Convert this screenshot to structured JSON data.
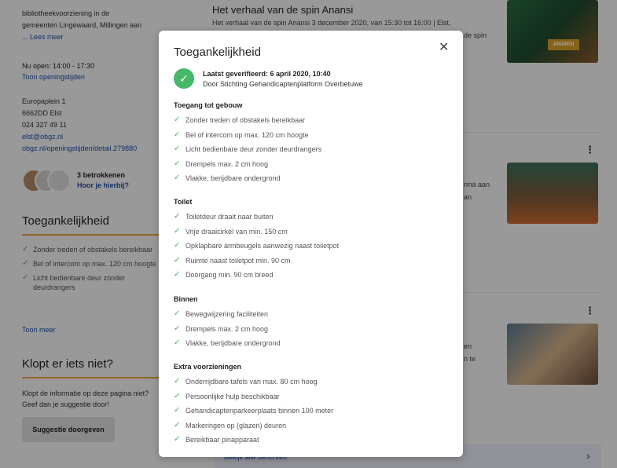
{
  "left": {
    "description_lines": [
      "bibliotheekvoorziening in de",
      "gemeenten Lingewaard, Millingen aan"
    ],
    "description_more": "... Lees meer",
    "open_now": "Nu open: 14:00 - 17:30",
    "show_hours": "Toon openingstijden",
    "address_line1": "Europaplein 1",
    "address_line2": "6662DD Elst",
    "phone": "024 327 49 11",
    "email": "elst@obgz.nl",
    "url": "obgz.nl/openingstijden/detail.279880",
    "involved_count": "3 betrokkenen",
    "involved_join": "Hoor je hierbij?",
    "accessibility_title": "Toegankelijkheid",
    "accessibility_items": [
      "Zonder treden of obstakels bereikbaar",
      "Bel of intercom op max. 120 cm hoogte",
      "Licht bedienbare deur zonder deurdrangers"
    ],
    "show_more": "Toon meer",
    "feedback_title": "Klopt er iets niet?",
    "feedback_text": "Klopt de informatie op deze pagina niet? Geef dan je suggestie door!",
    "feedback_button": "Suggestie doorgeven"
  },
  "right": {
    "story_title": "Het verhaal van de spin Anansi",
    "story_text": "Het verhaal van de spin Anansi 3 december 2020, van 15:30 tot 16:00 | Elst,",
    "story_frag": "de spin",
    "thumb1_label": "ANANSI",
    "frag_a": "rma aan",
    "frag_b": "an",
    "frag_c": "en",
    "frag_d": "n te",
    "kebab": "⋮",
    "bottom_link": "Bekijk alle berichten",
    "bottom_arrow": "›"
  },
  "modal": {
    "title": "Toegankelijkheid",
    "close": "✕",
    "verified_line1": "Laatst geverifieerd: 6 april 2020, 10:40",
    "verified_line2": "Door Stichting Gehandicaptenplatform Overbetuwe",
    "verified_icon": "✓",
    "categories": [
      {
        "title": "Toegang tot gebouw",
        "items": [
          "Zonder treden of obstakels bereikbaar",
          "Bel of intercom op max. 120 cm hoogte",
          "Licht bedienbare deur zonder deurdrangers",
          "Drempels max. 2 cm hoog",
          "Vlakke, berijdbare ondergrond"
        ]
      },
      {
        "title": "Toilet",
        "items": [
          "Toiletdeur draait naar buiten",
          "Vrije draaicirkel van min. 150 cm",
          "Opklapbare armbeugels aanwezig naast toiletpot",
          "Ruimte naast toiletpot min. 90 cm",
          "Doorgang min. 90 cm breed"
        ]
      },
      {
        "title": "Binnen",
        "items": [
          "Bewegwijzering faciliteiten",
          "Drempels max. 2 cm hoog",
          "Vlakke, berijdbare ondergrond"
        ]
      },
      {
        "title": "Extra voorzieningen",
        "items": [
          "Onderrijdbare tafels van max. 80 cm hoog",
          "Persoonlijke hulp beschikbaar",
          "Gehandicaptenparkeerplaats binnen 100 meter",
          "Markeringen op (glazen) deuren",
          "Bereikbaar pinapparaat"
        ]
      }
    ]
  },
  "icons": {
    "check": "✓"
  },
  "colors": {
    "accent_orange": "#e8a23f",
    "link_blue": "#1f4fa8",
    "check_green": "#4caf50",
    "badge_green": "#46b86a"
  }
}
